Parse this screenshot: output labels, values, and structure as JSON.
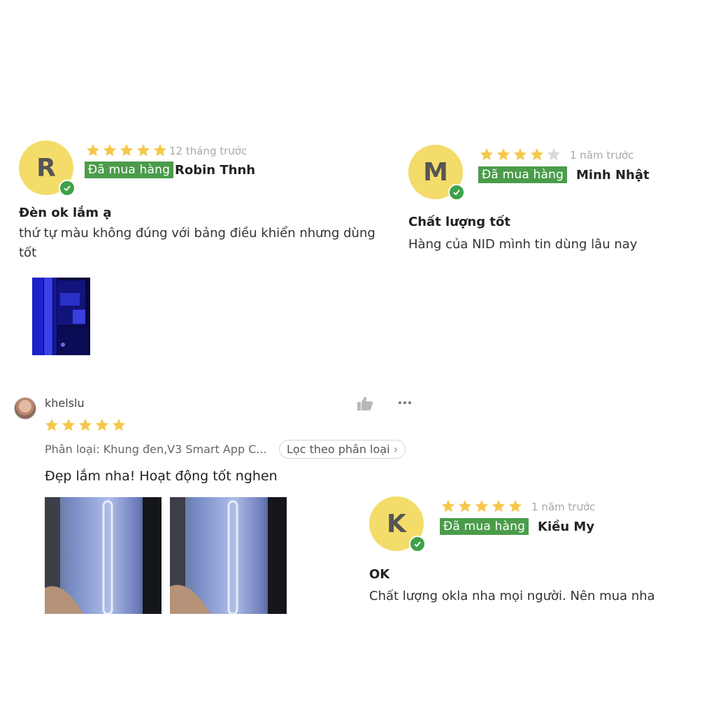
{
  "reviews": [
    {
      "avatar_letter": "R",
      "rating": 5,
      "time": "12 tháng trước",
      "badge": "Đã mua hàng",
      "name": "Robin Thnh",
      "title": "Đèn ok lắm ạ",
      "body": "thứ tự màu không đúng với bảng điều khiển nhưng dùng tốt"
    },
    {
      "avatar_letter": "M",
      "rating": 4,
      "time": "1 năm trước",
      "badge": "Đã mua hàng",
      "name": "Minh Nhật",
      "title": "Chất lượng tốt",
      "body": "Hàng của NID mình tin dùng lâu nay"
    },
    {
      "avatar_letter": "K",
      "rating": 5,
      "time": "1 năm trước",
      "badge": "Đã mua hàng",
      "name": "Kiều My",
      "title": "OK",
      "body": "Chất lượng okla nha mọi người. Nên mua nha"
    }
  ],
  "app_review": {
    "username": "khelslu",
    "rating": 5,
    "variant": "Phân loại: Khung đen,V3 Smart App C...",
    "filter_chip": "Lọc theo phân loại",
    "comment": "Đẹp lắm nha! Hoạt động tốt nghen",
    "more_icon": "more-dots-icon",
    "like_icon": "thumbs-up-icon"
  },
  "colors": {
    "star": "#f5c84b",
    "star_empty": "#d9d9d9",
    "badge": "#4a9c4a",
    "avatar": "#f4dc6a",
    "verified": "#3fa14a"
  }
}
